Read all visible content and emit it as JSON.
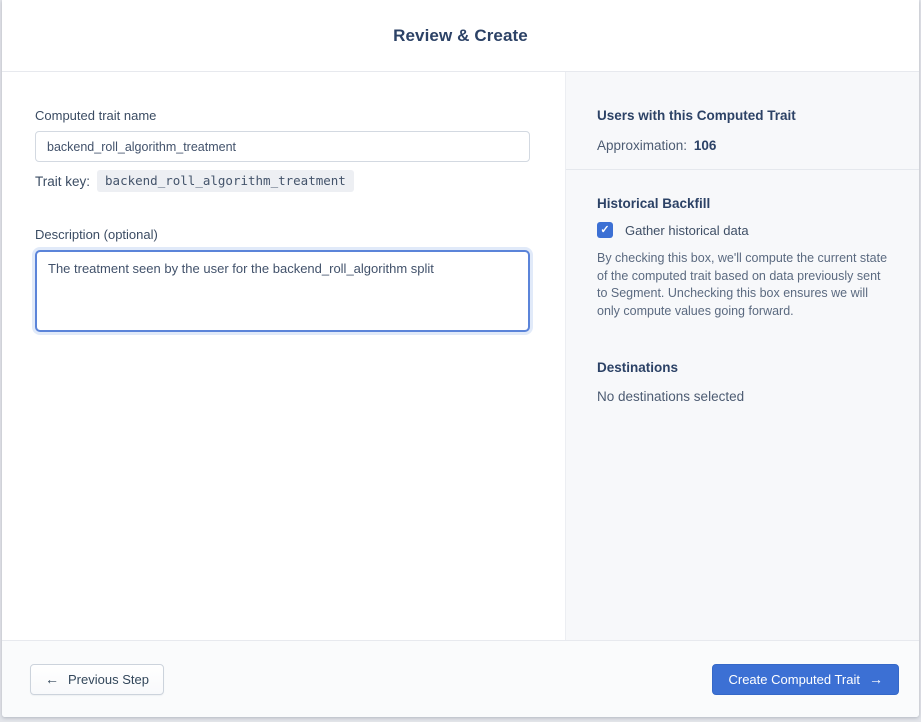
{
  "header": {
    "title": "Review & Create"
  },
  "form": {
    "name_label": "Computed trait name",
    "name_value": "backend_roll_algorithm_treatment",
    "trait_key_label": "Trait key:",
    "trait_key_value": "backend_roll_algorithm_treatment",
    "description_label": "Description (optional)",
    "description_value": "The treatment seen by the user for the backend_roll_algorithm split"
  },
  "summary": {
    "users_heading": "Users with this Computed Trait",
    "approximation_label": "Approximation:",
    "approximation_value": "106",
    "backfill_heading": "Historical Backfill",
    "backfill_checkbox_label": "Gather historical data",
    "backfill_checkbox_checked": "true",
    "backfill_description": "By checking this box, we'll compute the current state of the computed trait based on data previously sent to Segment. Unchecking this box ensures we will only compute values going forward.",
    "destinations_heading": "Destinations",
    "destinations_empty": "No destinations selected"
  },
  "footer": {
    "previous_label": "Previous Step",
    "create_label": "Create Computed Trait"
  },
  "icons": {
    "back_arrow": "←",
    "forward_arrow": "→",
    "check": "✓"
  },
  "colors": {
    "accent_blue": "#3c70d4",
    "focus_border": "#5b84d9",
    "panel_bg": "#f7f8fa"
  }
}
